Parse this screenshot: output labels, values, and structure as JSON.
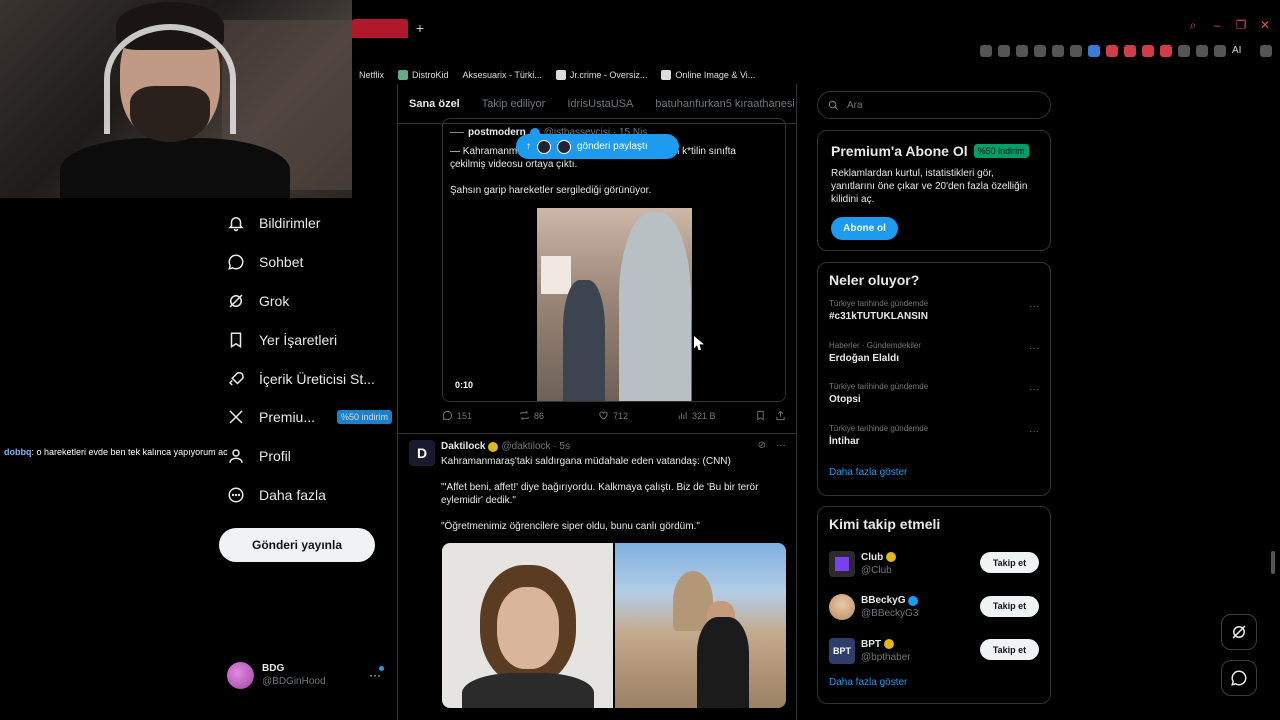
{
  "browser": {
    "bookmarks": [
      {
        "label": "Netflix"
      },
      {
        "label": "DistroKid"
      },
      {
        "label": "Aksesuarix - Türki..."
      },
      {
        "label": "Jr.crime - Oversiz..."
      },
      {
        "label": "Online Image & Vi..."
      }
    ],
    "ai_label": "AI"
  },
  "nav": {
    "items": [
      {
        "label": "Bildirimler",
        "icon": "bell-icon"
      },
      {
        "label": "Sohbet",
        "icon": "chat-icon"
      },
      {
        "label": "Grok",
        "icon": "grok-icon"
      },
      {
        "label": "Yer İşaretleri",
        "icon": "bookmark-icon"
      },
      {
        "label": "İçerik Üreticisi St...",
        "icon": "rocket-icon"
      },
      {
        "label": "Premiu...",
        "icon": "x-logo-icon",
        "badge": "%50 indirim"
      },
      {
        "label": "Profil",
        "icon": "person-icon"
      },
      {
        "label": "Daha fazla",
        "icon": "more-circle-icon"
      }
    ],
    "post_button": "Gönderi yayınla"
  },
  "chat_overlay": {
    "user": "dobbq",
    "message": ": o hareketleri evde ben tek kalınca yapıyorum ac"
  },
  "account": {
    "name": "BDG",
    "handle": "@BDGinHood",
    "more": "···"
  },
  "main": {
    "tabs": [
      {
        "label": "Sana özel",
        "active": true
      },
      {
        "label": "Takip ediliyor",
        "active": false
      },
      {
        "label": "IdrisUstaUSA",
        "active": false
      },
      {
        "label": "batuhanfurkan5 kıraathanesi",
        "active": false
      }
    ],
    "quote": {
      "author": "postmodern",
      "handle": "@isthassevcisi · 15 Nis",
      "line1_start": "— Kahramanm",
      "line1_end": "n k*tilin sınıfta",
      "line2": "çekilmiş videosu ortaya çıktı.",
      "line3": "Şahsın garip hareketler sergilediği görünüyor.",
      "video_time": "0:10"
    },
    "actions": {
      "replies": "151",
      "reposts": "86",
      "likes": "712",
      "views": "321 B"
    },
    "post2": {
      "avatar_letter": "D",
      "author": "Daktilock",
      "handle": "@daktilock · 5s",
      "para1": "Kahramanmaraş'taki saldırgana müdahale eden vatandaş: (CNN)",
      "para2": "\"'Affet beni, affet!' diye bağırıyordu. Kalkmaya çalıştı. Biz de 'Bu bir terör eylemidir' dedik.\"",
      "para3": "\"Öğretmenimiz öğrencilere siper oldu, bunu canlı gördüm.\"",
      "more": "···"
    },
    "share_pill": "gönderi paylaştı"
  },
  "sidebar": {
    "search_placeholder": "Ara",
    "premium": {
      "title": "Premium'a Abone Ol",
      "badge": "%50 indirim",
      "text": "Reklamlardan kurtul, istatistikleri gör, yanıtlarını öne çıkar ve 20'den fazla özelliğin kilidini aç.",
      "button": "Abone ol"
    },
    "trends": {
      "title": "Neler oluyor?",
      "items": [
        {
          "context": "Türkiye tarihinde gündemde",
          "topic": "#c31kTUTUKLANSIN"
        },
        {
          "context": "Haberler · Gündemdekiler",
          "topic": "Erdoğan Elaldı"
        },
        {
          "context": "Türkiye tarihinde gündemde",
          "topic": "Otopsi"
        },
        {
          "context": "Türkiye tarihinde gündemde",
          "topic": "İntihar"
        }
      ],
      "show_more": "Daha fazla göster",
      "dots": "···"
    },
    "follow": {
      "title": "Kimi takip etmeli",
      "items": [
        {
          "name": "Club",
          "handle": "@Club",
          "verified": "gold",
          "button": "Takip et"
        },
        {
          "name": "BBeckyG",
          "handle": "@BBeckyG3",
          "verified": "blue",
          "button": "Takip et"
        },
        {
          "name": "BPT",
          "handle": "@bpthaber",
          "verified": "gold",
          "button": "Takip et",
          "avatar_text": "BPT"
        }
      ],
      "show_more": "Daha fazla göster"
    }
  },
  "colors": {
    "accent": "#1d9bf0",
    "background": "#000000",
    "border": "#2f3336",
    "muted": "#71767b",
    "gold": "#e2b719",
    "green": "#00ba7c"
  }
}
